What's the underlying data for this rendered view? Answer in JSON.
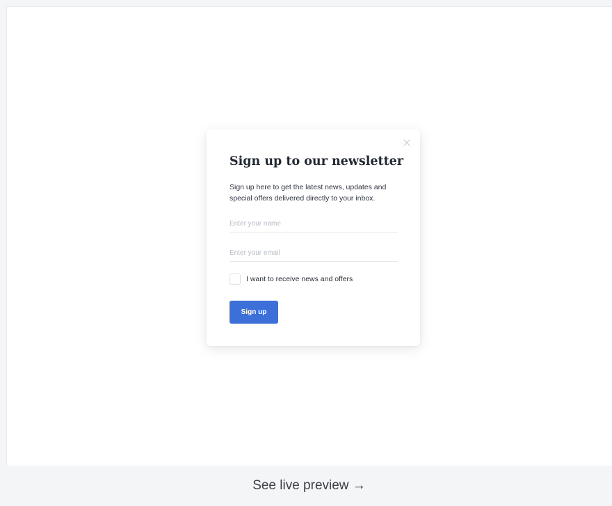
{
  "modal": {
    "title": "Sign up to our newsletter",
    "description": "Sign up here to get the latest news, updates and special offers delivered directly to your inbox.",
    "name_field": {
      "value": "",
      "placeholder": "Enter your name"
    },
    "email_field": {
      "value": "",
      "placeholder": "Enter your email"
    },
    "checkbox": {
      "label": "I want to receive news and offers",
      "checked": false
    },
    "submit_label": "Sign up",
    "close_icon": "close-icon"
  },
  "footer": {
    "preview_label": "See live preview →"
  },
  "colors": {
    "accent": "#3d6fd8",
    "title_text": "#222831",
    "page_background": "#f4f5f7",
    "card_background": "#ffffff"
  }
}
